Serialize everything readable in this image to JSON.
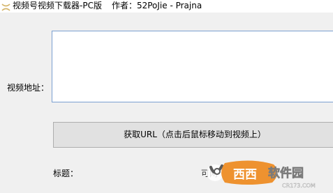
{
  "window": {
    "title": "视频号视频下载器-PC版",
    "author": "作者：52PoJie - Prajna"
  },
  "form": {
    "url_label": "视频地址：",
    "url_value": "",
    "get_url_button": "获取URL（点击后鼠标移动到视频上）",
    "title_label": "标题：",
    "partial_text": "可网"
  },
  "watermark": {
    "brand": "西西软件园",
    "site": "CR173.COM"
  }
}
